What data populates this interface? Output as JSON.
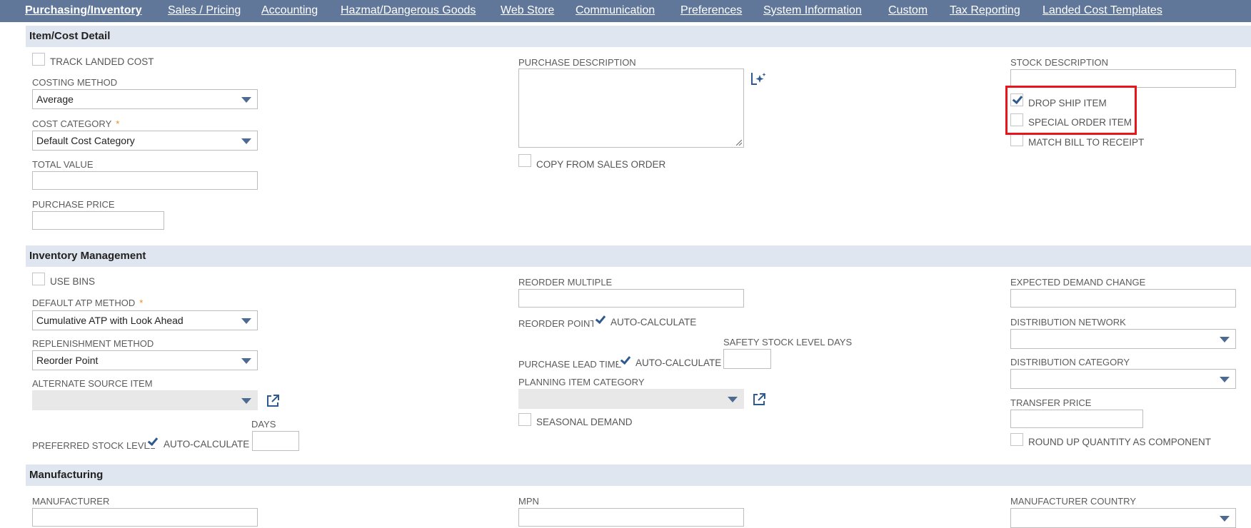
{
  "tabs": [
    {
      "label": "Purchasing/Inventory",
      "active": true
    },
    {
      "label": "Sales / Pricing"
    },
    {
      "label": "Accounting"
    },
    {
      "label": "Hazmat/Dangerous Goods"
    },
    {
      "label": "Web Store"
    },
    {
      "label": "Communication"
    },
    {
      "label": "Preferences"
    },
    {
      "label": "System Information"
    },
    {
      "label": "Custom"
    },
    {
      "label": "Tax Reporting"
    },
    {
      "label": "Landed Cost Templates"
    }
  ],
  "item_cost": {
    "title": "Item/Cost Detail",
    "track_landed_cost": {
      "label": "TRACK LANDED COST",
      "checked": false
    },
    "costing_method": {
      "label": "COSTING METHOD",
      "value": "Average"
    },
    "cost_category": {
      "label": "COST CATEGORY",
      "required": "*",
      "value": "Default Cost Category"
    },
    "total_value": {
      "label": "TOTAL VALUE",
      "value": ""
    },
    "purchase_price": {
      "label": "PURCHASE PRICE",
      "value": ""
    },
    "purchase_description": {
      "label": "PURCHASE DESCRIPTION",
      "value": ""
    },
    "copy_from_sales_order": {
      "label": "COPY FROM SALES ORDER",
      "checked": false
    },
    "stock_description": {
      "label": "STOCK DESCRIPTION",
      "value": ""
    },
    "drop_ship_item": {
      "label": "DROP SHIP ITEM",
      "checked": true
    },
    "special_order_item": {
      "label": "SPECIAL ORDER ITEM",
      "checked": false
    },
    "match_bill_to_receipt": {
      "label": "MATCH BILL TO RECEIPT",
      "checked": false
    }
  },
  "inventory": {
    "title": "Inventory Management",
    "use_bins": {
      "label": "USE BINS",
      "checked": false
    },
    "default_atp_method": {
      "label": "DEFAULT ATP METHOD",
      "required": "*",
      "value": "Cumulative ATP with Look Ahead"
    },
    "replenishment_method": {
      "label": "REPLENISHMENT METHOD",
      "value": "Reorder Point"
    },
    "alternate_source_item": {
      "label": "ALTERNATE SOURCE ITEM",
      "value": ""
    },
    "preferred_stock_level": {
      "label": "PREFERRED STOCK LEVEL",
      "auto_label": "AUTO-CALCULATE",
      "auto_checked": true,
      "days_label": "DAYS"
    },
    "reorder_multiple": {
      "label": "REORDER MULTIPLE",
      "value": ""
    },
    "reorder_point": {
      "label": "REORDER POINT",
      "auto_label": "AUTO-CALCULATE",
      "auto_checked": true
    },
    "purchase_lead_time": {
      "label": "PURCHASE LEAD TIME",
      "auto_label": "AUTO-CALCULATE",
      "auto_checked": true
    },
    "safety_stock_level_days": {
      "label": "SAFETY STOCK LEVEL DAYS",
      "value": ""
    },
    "planning_item_category": {
      "label": "PLANNING ITEM CATEGORY",
      "value": ""
    },
    "seasonal_demand": {
      "label": "SEASONAL DEMAND",
      "checked": false
    },
    "expected_demand_change": {
      "label": "EXPECTED DEMAND CHANGE",
      "value": ""
    },
    "distribution_network": {
      "label": "DISTRIBUTION NETWORK",
      "value": ""
    },
    "distribution_category": {
      "label": "DISTRIBUTION CATEGORY",
      "value": ""
    },
    "transfer_price": {
      "label": "TRANSFER PRICE",
      "value": ""
    },
    "round_up_quantity": {
      "label": "ROUND UP QUANTITY AS COMPONENT",
      "checked": false
    }
  },
  "manufacturing": {
    "title": "Manufacturing",
    "manufacturer": {
      "label": "MANUFACTURER"
    },
    "mpn": {
      "label": "MPN"
    },
    "manufacturer_country": {
      "label": "MANUFACTURER COUNTRY"
    }
  },
  "colors": {
    "tab_bar": "#607799",
    "section_header": "#e0e6ef",
    "required": "#e88b1c",
    "highlight": "#e8151b",
    "accent": "#2f5a8f"
  }
}
